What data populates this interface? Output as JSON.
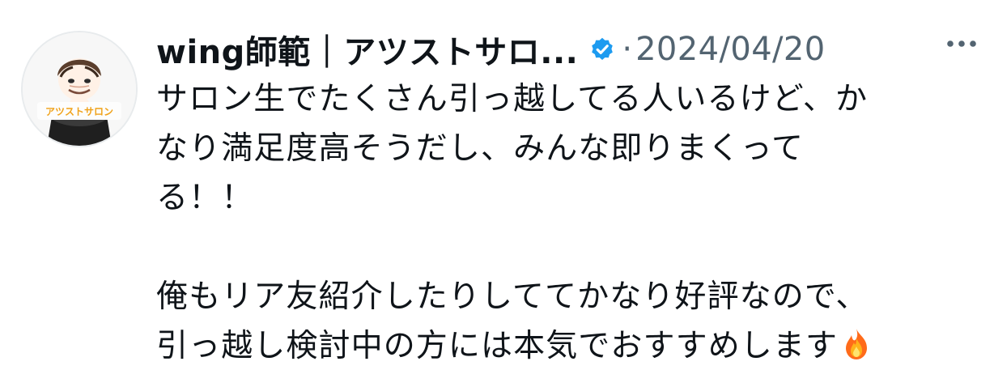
{
  "header": {
    "display_name": "wing師範｜アツストサロ...",
    "separator": "·",
    "date": "2024/04/20"
  },
  "tweet": {
    "lines": [
      "サロン生でたくさん引っ越してる人いるけど、か",
      "なり満足度高そうだし、みんな即りまくって",
      "る！！",
      "",
      "俺もリア友紹介したりしててかなり好評なので、",
      "引っ越し検討中の方には本気でおすすめします"
    ],
    "emoji": "fire"
  },
  "avatar": {
    "logo_text": "アツストサロン"
  },
  "colors": {
    "text": "#0f1419",
    "secondary": "#536471",
    "verified": "#1d9bf0",
    "logo": "#f0a21a"
  },
  "icons": {
    "verified": "verified-badge-icon",
    "more": "more-icon",
    "emoji": "fire-emoji-icon"
  }
}
